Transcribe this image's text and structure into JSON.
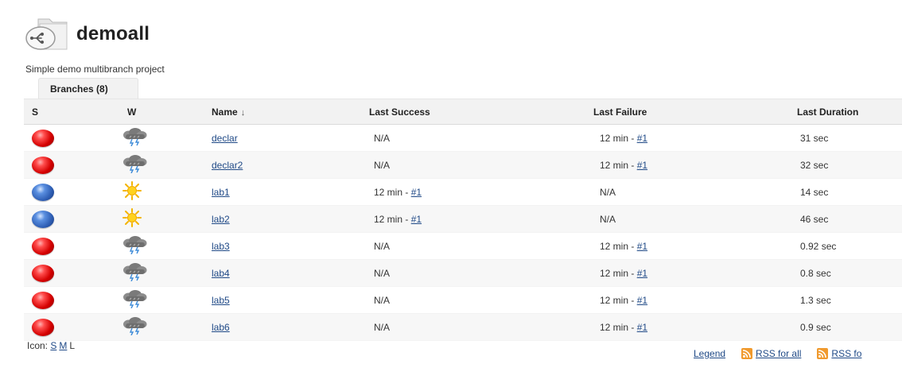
{
  "header": {
    "title": "demoall",
    "description": "Simple demo multibranch project"
  },
  "tabs": [
    {
      "label": "Branches (8)",
      "active": true
    }
  ],
  "table": {
    "columns": {
      "s": "S",
      "w": "W",
      "name": "Name",
      "name_sort": "↓",
      "last_success": "Last Success",
      "last_failure": "Last Failure",
      "last_duration": "Last Duration"
    },
    "rows": [
      {
        "status": "red",
        "weather": "storm-icon",
        "name": "declar",
        "success_time": "N/A",
        "success_build": "",
        "failure_time": "12 min - ",
        "failure_build": "#1",
        "duration": "31 sec"
      },
      {
        "status": "red",
        "weather": "storm-icon",
        "name": "declar2",
        "success_time": "N/A",
        "success_build": "",
        "failure_time": "12 min - ",
        "failure_build": "#1",
        "duration": "32 sec"
      },
      {
        "status": "blue",
        "weather": "sun-icon",
        "name": "lab1",
        "success_time": "12 min - ",
        "success_build": "#1",
        "failure_time": "N/A",
        "failure_build": "",
        "duration": "14 sec"
      },
      {
        "status": "blue",
        "weather": "sun-icon",
        "name": "lab2",
        "success_time": "12 min - ",
        "success_build": "#1",
        "failure_time": "N/A",
        "failure_build": "",
        "duration": "46 sec"
      },
      {
        "status": "red",
        "weather": "storm-icon",
        "name": "lab3",
        "success_time": "N/A",
        "success_build": "",
        "failure_time": "12 min - ",
        "failure_build": "#1",
        "duration": "0.92 sec"
      },
      {
        "status": "red",
        "weather": "storm-icon",
        "name": "lab4",
        "success_time": "N/A",
        "success_build": "",
        "failure_time": "12 min - ",
        "failure_build": "#1",
        "duration": "0.8 sec"
      },
      {
        "status": "red",
        "weather": "storm-icon",
        "name": "lab5",
        "success_time": "N/A",
        "success_build": "",
        "failure_time": "12 min - ",
        "failure_build": "#1",
        "duration": "1.3 sec"
      },
      {
        "status": "red",
        "weather": "storm-icon",
        "name": "lab6",
        "success_time": "N/A",
        "success_build": "",
        "failure_time": "12 min - ",
        "failure_build": "#1",
        "duration": "0.9 sec"
      }
    ]
  },
  "footer": {
    "icon_label": "Icon:",
    "icon_sizes": [
      "S",
      "M",
      "L"
    ],
    "legend": "Legend",
    "rss_all": "RSS for all",
    "rss_failures": "RSS fo"
  },
  "colors": {
    "link": "#204A87",
    "status_red": "#d40000",
    "status_blue": "#2f5fb5",
    "header_bg": "#f2f2f2"
  }
}
